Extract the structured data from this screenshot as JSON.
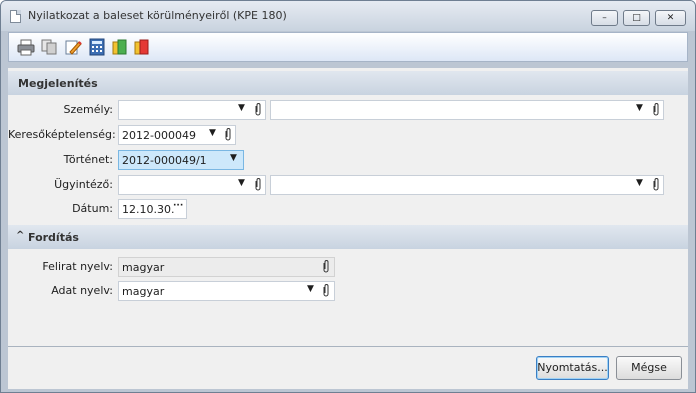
{
  "window": {
    "title": "Nyilatkozat a baleset körülményeiről (KPE 180)"
  },
  "caption_buttons": {
    "minimize": "–",
    "maximize": "□",
    "close": "✕"
  },
  "toolbar": {
    "icons": [
      "printer-icon",
      "copy-icon",
      "edit-icon",
      "calculator-icon",
      "export-green-icon",
      "export-red-icon"
    ]
  },
  "sections": {
    "megjelenites": {
      "title": "Megjelenítés"
    },
    "forditas": {
      "title": "Fordítás",
      "chevron": "^"
    }
  },
  "form": {
    "szemely": {
      "label": "Személy:",
      "value": "",
      "value2": ""
    },
    "keresokeptelenseg": {
      "label": "Keresőképtelenség:",
      "value": "2012-000049"
    },
    "tortenet": {
      "label": "Történet:",
      "value": "2012-000049/1"
    },
    "ugyintezo": {
      "label": "Ügyintéző:",
      "value": "",
      "value2": ""
    },
    "datum": {
      "label": "Dátum:",
      "value": "12.10.30.",
      "ellipsis": "···"
    },
    "felirat_nyelv": {
      "label": "Felirat nyelv:",
      "value": "magyar"
    },
    "adat_nyelv": {
      "label": "Adat nyelv:",
      "value": "magyar"
    }
  },
  "buttons": {
    "print": "Nyomtatás...",
    "cancel": "Mégse"
  },
  "colors": {
    "highlight_field": "#cde8fb",
    "toolbar_gradient_bottom": "#dde7f6",
    "section_header": "#c8d3e0"
  }
}
